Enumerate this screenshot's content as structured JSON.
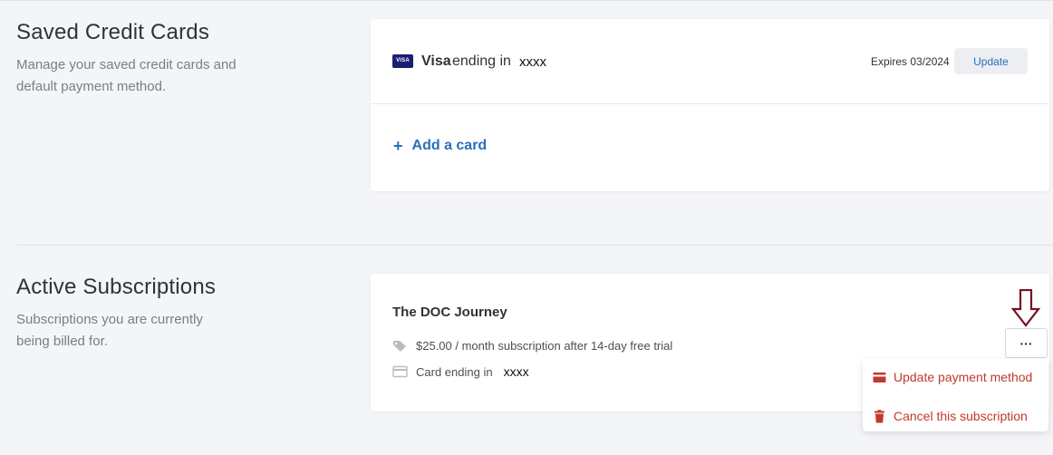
{
  "saved_cards": {
    "title": "Saved Credit Cards",
    "description_line1": "Manage your saved credit cards and",
    "description_line2": "default payment method.",
    "card": {
      "logo_text": "VISA",
      "brand": "Visa",
      "ending_label": "ending in",
      "last4": "xxxx",
      "expires": "Expires 03/2024",
      "update_label": "Update"
    },
    "add_card": {
      "icon": "+",
      "label": "Add a card"
    }
  },
  "subscriptions": {
    "title": "Active Subscriptions",
    "description_line1": "Subscriptions you are currently",
    "description_line2": "being billed for.",
    "item": {
      "name": "The DOC Journey",
      "price_text": "$25.00 / month subscription after 14-day free trial",
      "card_label": "Card ending in",
      "card_last4": "xxxx",
      "more_label": "···"
    },
    "menu": {
      "update_payment": "Update payment method",
      "cancel": "Cancel this subscription"
    }
  },
  "colors": {
    "accent_blue": "#2a6ebb",
    "danger_red": "#c0392b",
    "annotation_arrow": "#7a1020",
    "visa_blue": "#1a1f71"
  },
  "icons": {
    "tag": "tag-icon",
    "card": "credit-card-icon",
    "update_payment": "credit-card-icon",
    "cancel": "trash-icon",
    "annotation": "down-arrow-icon"
  }
}
